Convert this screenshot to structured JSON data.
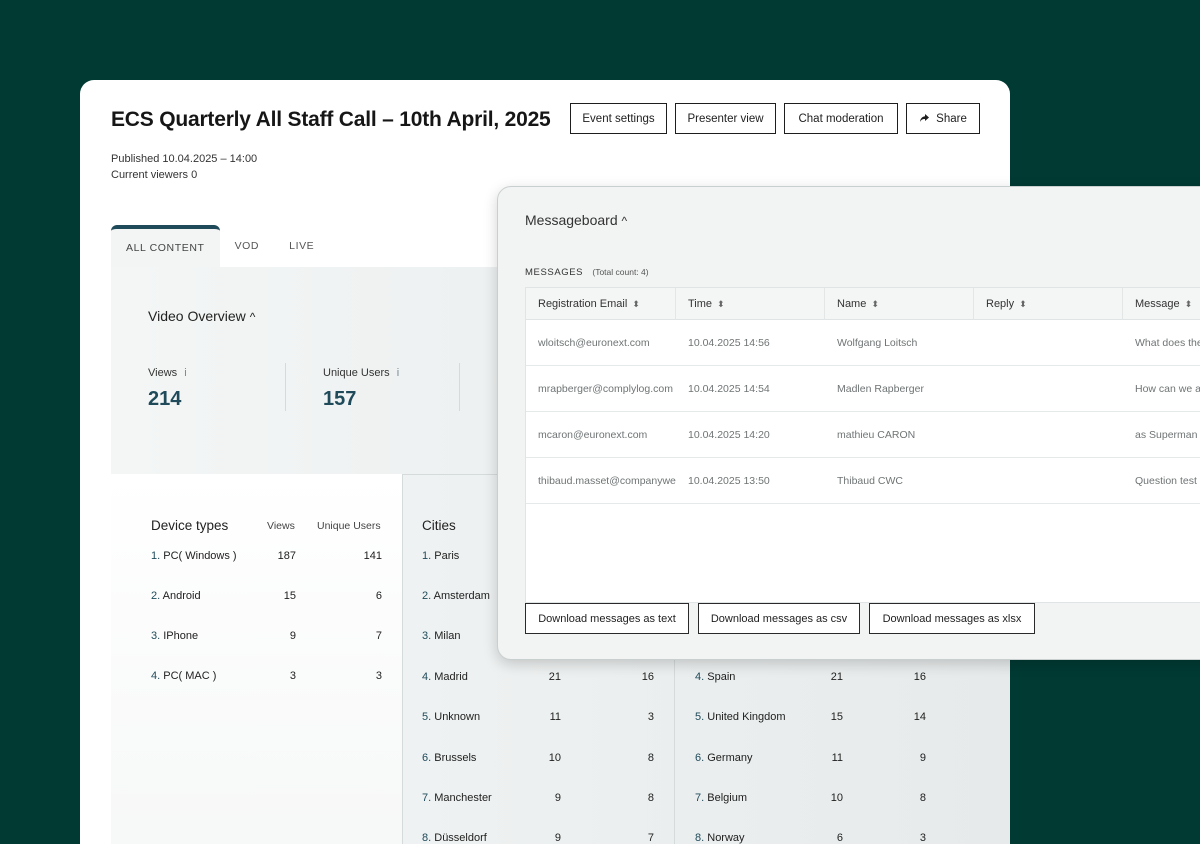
{
  "event": {
    "title": "ECS Quarterly All Staff Call – 10th April, 2025",
    "published": "Published 10.04.2025 – 14:00",
    "viewers": "Current viewers 0"
  },
  "header_buttons": {
    "event_settings": "Event settings",
    "presenter_view": "Presenter view",
    "chat_moderation": "Chat moderation",
    "share": "Share"
  },
  "tabs": [
    {
      "label": "ALL CONTENT",
      "active": true
    },
    {
      "label": "VOD",
      "active": false
    },
    {
      "label": "LIVE",
      "active": false
    }
  ],
  "video_overview": {
    "title": "Video Overview",
    "chevron": "^",
    "info_icon": "i",
    "views_label": "Views",
    "views_value": "214",
    "unique_label": "Unique Users",
    "unique_value": "157"
  },
  "device_types": {
    "title": "Device types",
    "col_views": "Views",
    "col_unique": "Unique Users",
    "rows": [
      {
        "num": "1.",
        "name": "PC( Windows )",
        "views": "187",
        "unique": "141"
      },
      {
        "num": "2.",
        "name": "Android",
        "views": "15",
        "unique": "6"
      },
      {
        "num": "3.",
        "name": "IPhone",
        "views": "9",
        "unique": "7"
      },
      {
        "num": "4.",
        "name": "PC( MAC )",
        "views": "3",
        "unique": "3"
      }
    ]
  },
  "cities": {
    "title": "Cities",
    "rows": [
      {
        "num": "1.",
        "name": "Paris",
        "views": "",
        "unique": ""
      },
      {
        "num": "2.",
        "name": "Amsterdam",
        "views": "",
        "unique": ""
      },
      {
        "num": "3.",
        "name": "Milan",
        "views": "",
        "unique": ""
      },
      {
        "num": "4.",
        "name": "Madrid",
        "views": "21",
        "unique": "16"
      },
      {
        "num": "5.",
        "name": "Unknown",
        "views": "11",
        "unique": "3"
      },
      {
        "num": "6.",
        "name": "Brussels",
        "views": "10",
        "unique": "8"
      },
      {
        "num": "7.",
        "name": "Manchester",
        "views": "9",
        "unique": "8"
      },
      {
        "num": "8.",
        "name": "Düsseldorf",
        "views": "9",
        "unique": "7"
      }
    ]
  },
  "countries": {
    "rows": [
      {
        "num": "4.",
        "name": "Spain",
        "views": "21",
        "unique": "16"
      },
      {
        "num": "5.",
        "name": "United Kingdom",
        "views": "15",
        "unique": "14"
      },
      {
        "num": "6.",
        "name": "Germany",
        "views": "11",
        "unique": "9"
      },
      {
        "num": "7.",
        "name": "Belgium",
        "views": "10",
        "unique": "8"
      },
      {
        "num": "8.",
        "name": "Norway",
        "views": "6",
        "unique": "3"
      }
    ]
  },
  "messageboard": {
    "title": "Messageboard",
    "chevron": "^",
    "messages_label": "MESSAGES",
    "total_count": "(Total count: 4)",
    "sort_icon": "⬍",
    "columns": [
      "Registration Email",
      "Time",
      "Name",
      "Reply",
      "Message"
    ],
    "rows": [
      {
        "email": "wloitsch@euronext.com",
        "time": "10.04.2025 14:56",
        "name": "Wolfgang Loitsch",
        "reply": "",
        "message": "What does the"
      },
      {
        "email": "mrapberger@complylog.com",
        "time": "10.04.2025 14:54",
        "name": "Madlen Rapberger",
        "reply": "",
        "message": "How can we a"
      },
      {
        "email": "mcaron@euronext.com",
        "time": "10.04.2025 14:20",
        "name": "mathieu CARON",
        "reply": "",
        "message": "as Superman"
      },
      {
        "email": "thibaud.masset@companyweb",
        "time": "10.04.2025 13:50",
        "name": "Thibaud CWC",
        "reply": "",
        "message": "Question test"
      }
    ],
    "download_text": "Download messages as text",
    "download_csv": "Download messages as csv",
    "download_xlsx": "Download messages as xlsx"
  },
  "colors": {
    "background": "#003a33",
    "accent": "#1e4a5a"
  }
}
